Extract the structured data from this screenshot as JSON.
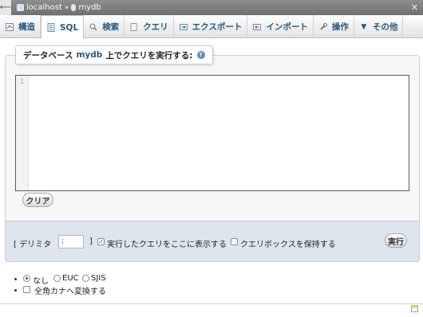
{
  "breadcrumb": {
    "server": "localhost",
    "separator": "»",
    "database": "mydb"
  },
  "tabs": [
    {
      "label": "構造",
      "icon": "structure-icon"
    },
    {
      "label": "SQL",
      "icon": "sql-icon",
      "active": true
    },
    {
      "label": "検索",
      "icon": "search-icon"
    },
    {
      "label": "クエリ",
      "icon": "query-icon"
    },
    {
      "label": "エクスポート",
      "icon": "export-icon"
    },
    {
      "label": "インポート",
      "icon": "import-icon"
    },
    {
      "label": "操作",
      "icon": "wrench-icon"
    },
    {
      "label": "その他",
      "icon": "chevron-down-icon"
    }
  ],
  "query": {
    "legend_prefix": "データベース",
    "db_name": "mydb",
    "legend_suffix": "上でクエリを実行する:",
    "help": "?",
    "line_number": "1",
    "clear_label": "クリア"
  },
  "options": {
    "delimiter_label_open": "[ デリミタ",
    "delimiter_value": ";",
    "delimiter_label_close": "]",
    "show_query_label": "実行したクエリをここに表示する",
    "show_query_checked": true,
    "keep_box_label": "クエリボックスを保持する",
    "keep_box_checked": false,
    "run_label": "実行"
  },
  "encoding": {
    "options": [
      "なし",
      "EUC",
      "SJIS"
    ],
    "selected": "なし",
    "kana_label": "全角カナへ変換する",
    "kana_checked": false
  },
  "colors": {
    "link": "#235a81",
    "option_bar": "#dde6ee"
  }
}
